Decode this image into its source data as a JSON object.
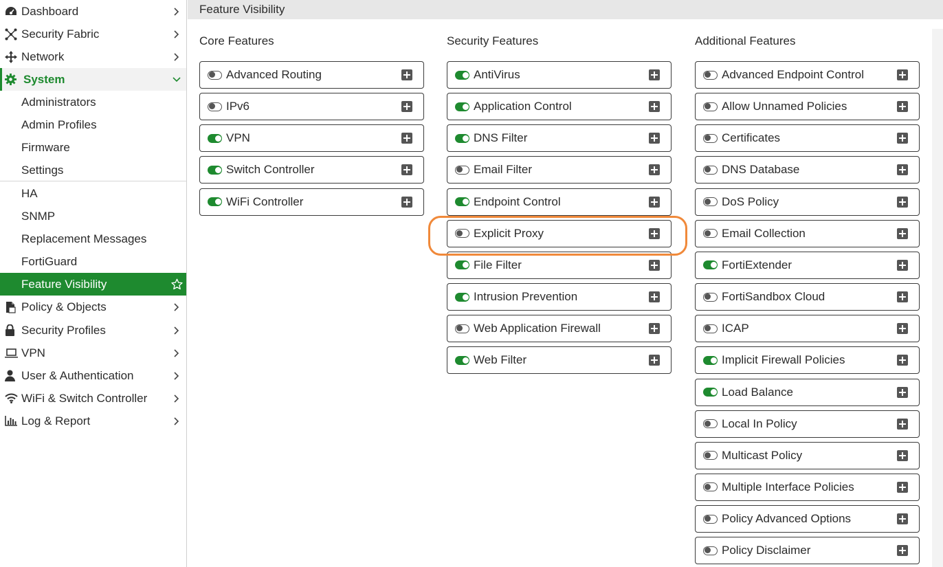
{
  "sidebar": {
    "items": [
      {
        "label": "Dashboard",
        "icon": "dashboard-icon"
      },
      {
        "label": "Security Fabric",
        "icon": "security-fabric-icon"
      },
      {
        "label": "Network",
        "icon": "network-icon"
      },
      {
        "label": "System",
        "icon": "gear-icon"
      },
      {
        "label": "Administrators"
      },
      {
        "label": "Admin Profiles"
      },
      {
        "label": "Firmware"
      },
      {
        "label": "Settings"
      },
      {
        "label": "HA"
      },
      {
        "label": "SNMP"
      },
      {
        "label": "Replacement Messages"
      },
      {
        "label": "FortiGuard"
      },
      {
        "label": "Feature Visibility",
        "icon": "star-icon"
      },
      {
        "label": "Policy & Objects",
        "icon": "policy-icon"
      },
      {
        "label": "Security Profiles",
        "icon": "lock-icon"
      },
      {
        "label": "VPN",
        "icon": "laptop-icon"
      },
      {
        "label": "User & Authentication",
        "icon": "user-icon"
      },
      {
        "label": "WiFi & Switch Controller",
        "icon": "wifi-icon"
      },
      {
        "label": "Log & Report",
        "icon": "bar-chart-icon"
      }
    ]
  },
  "header": {
    "title": "Feature Visibility"
  },
  "columns": {
    "core": {
      "title": "Core Features",
      "features": [
        {
          "label": "Advanced Routing",
          "enabled": false
        },
        {
          "label": "IPv6",
          "enabled": false
        },
        {
          "label": "VPN",
          "enabled": true
        },
        {
          "label": "Switch Controller",
          "enabled": true
        },
        {
          "label": "WiFi Controller",
          "enabled": true
        }
      ]
    },
    "security": {
      "title": "Security Features",
      "features": [
        {
          "label": "AntiVirus",
          "enabled": true
        },
        {
          "label": "Application Control",
          "enabled": true
        },
        {
          "label": "DNS Filter",
          "enabled": true
        },
        {
          "label": "Email Filter",
          "enabled": false
        },
        {
          "label": "Endpoint Control",
          "enabled": true
        },
        {
          "label": "Explicit Proxy",
          "enabled": false
        },
        {
          "label": "File Filter",
          "enabled": true
        },
        {
          "label": "Intrusion Prevention",
          "enabled": true
        },
        {
          "label": "Web Application Firewall",
          "enabled": false
        },
        {
          "label": "Web Filter",
          "enabled": true
        }
      ]
    },
    "additional": {
      "title": "Additional Features",
      "features": [
        {
          "label": "Advanced Endpoint Control",
          "enabled": false
        },
        {
          "label": "Allow Unnamed Policies",
          "enabled": false
        },
        {
          "label": "Certificates",
          "enabled": false
        },
        {
          "label": "DNS Database",
          "enabled": false
        },
        {
          "label": "DoS Policy",
          "enabled": false
        },
        {
          "label": "Email Collection",
          "enabled": false
        },
        {
          "label": "FortiExtender",
          "enabled": true
        },
        {
          "label": "FortiSandbox Cloud",
          "enabled": false
        },
        {
          "label": "ICAP",
          "enabled": false
        },
        {
          "label": "Implicit Firewall Policies",
          "enabled": true
        },
        {
          "label": "Load Balance",
          "enabled": true
        },
        {
          "label": "Local In Policy",
          "enabled": false
        },
        {
          "label": "Multicast Policy",
          "enabled": false
        },
        {
          "label": "Multiple Interface Policies",
          "enabled": false
        },
        {
          "label": "Policy Advanced Options",
          "enabled": false
        },
        {
          "label": "Policy Disclaimer",
          "enabled": false
        }
      ]
    }
  },
  "colors": {
    "accent": "#1e8a2f",
    "highlight": "#f0893a"
  }
}
